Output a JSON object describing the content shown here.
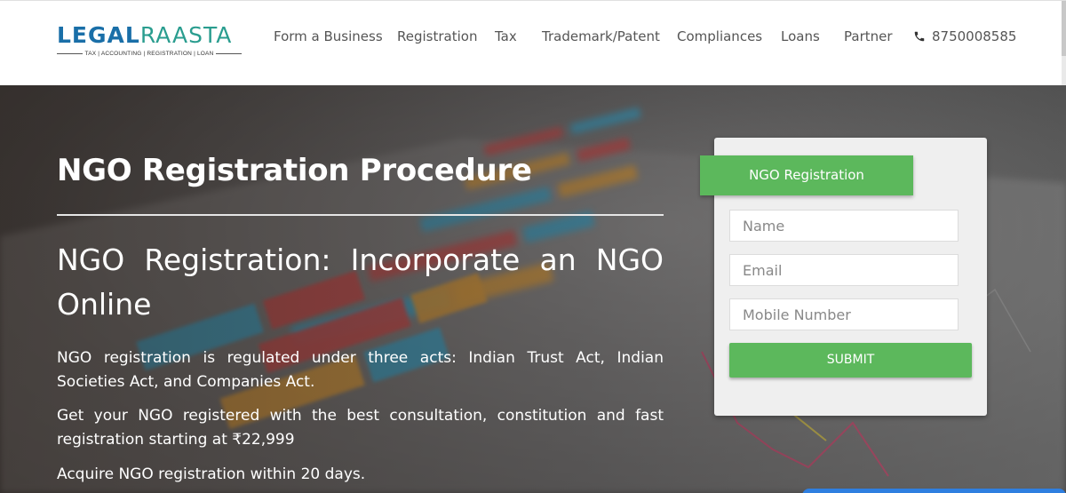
{
  "logo": {
    "brand_bold": "LEGAL",
    "brand_light": "RAASTA",
    "tagline": "TAX | ACCOUNTING | REGISTRATION | LOAN"
  },
  "nav": {
    "items": [
      "Form a Business",
      "Registration",
      "Tax",
      "Trademark/Patent",
      "Compliances",
      "Loans",
      "Partner"
    ],
    "phone_icon": "phone-icon",
    "phone": "8750008585"
  },
  "hero": {
    "title": "NGO Registration Procedure",
    "subtitle": "NGO Registration: Incorporate an NGO Online",
    "paragraphs": [
      "NGO registration is regulated under three acts: Indian Trust Act,  Indian Societies Act, and Companies Act.",
      "Get your NGO registered with the best consultation, constitution and fast registration starting at  ₹22,999",
      "Acquire NGO registration within 20 days."
    ]
  },
  "form": {
    "tab_label": "NGO Registration",
    "name_placeholder": "Name",
    "email_placeholder": "Email",
    "mobile_placeholder": "Mobile Number",
    "submit_label": "SUBMIT"
  },
  "colors": {
    "brand_blue": "#1a6fa8",
    "brand_teal": "#2a9d8f",
    "accent_green": "#5cb85c",
    "chat_blue": "#2f7fe0"
  }
}
